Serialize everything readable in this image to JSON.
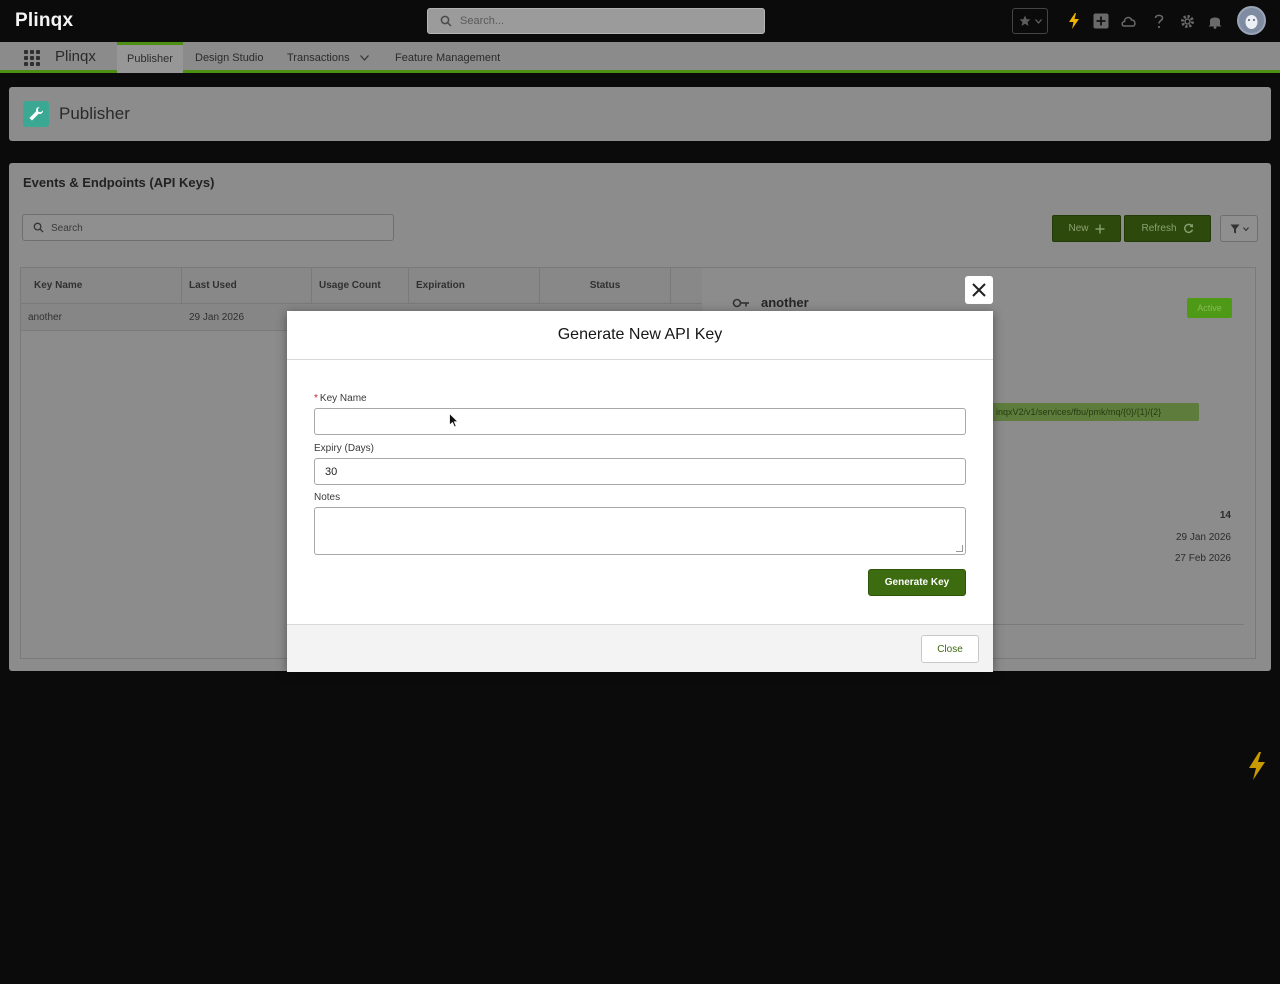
{
  "brand": "Plinqx",
  "global_search": {
    "placeholder": "Search..."
  },
  "header_icons": [
    "favorites-star-icon",
    "chevron-down-icon",
    "bolt-icon",
    "add-icon",
    "setup-cloud-icon",
    "help-icon",
    "gear-icon",
    "bell-icon"
  ],
  "app_nav": {
    "app_name": "Plinqx",
    "tabs": [
      {
        "label": "Publisher",
        "active": true
      },
      {
        "label": "Design Studio",
        "active": false
      },
      {
        "label": "Transactions",
        "active": false,
        "dropdown": true
      },
      {
        "label": "Feature Management",
        "active": false
      }
    ]
  },
  "page_header": {
    "title": "Publisher",
    "icon": "wrench-icon"
  },
  "main": {
    "title": "Events & Endpoints (API Keys)",
    "search_placeholder": "Search",
    "new_label": "New",
    "refresh_label": "Refresh",
    "table": {
      "columns": [
        "Key Name",
        "Last Used",
        "Usage Count",
        "Expiration",
        "Status"
      ],
      "rows": [
        {
          "key_name": "another",
          "last_used": "29 Jan 2026",
          "usage_count": "",
          "expiration": "",
          "status": ""
        }
      ]
    },
    "detail": {
      "name": "another",
      "status": "Active",
      "url": "inqxV2/v1/services/fbu/pmk/mq/{0}/{1}/{2}",
      "usage_count": "14",
      "last_used": "29 Jan 2026",
      "expiration": "27 Feb 2026"
    }
  },
  "modal": {
    "title": "Generate New API Key",
    "key_name_label": "Key Name",
    "key_name_value": "",
    "expiry_label": "Expiry (Days)",
    "expiry_value": "30",
    "notes_label": "Notes",
    "notes_value": "",
    "generate_label": "Generate Key",
    "close_label": "Close"
  },
  "colors": {
    "accent_green": "#4d8f12",
    "button_green": "#3d6b0f",
    "required_red": "#c0262d",
    "bolt_yellow": "#f0b400"
  }
}
